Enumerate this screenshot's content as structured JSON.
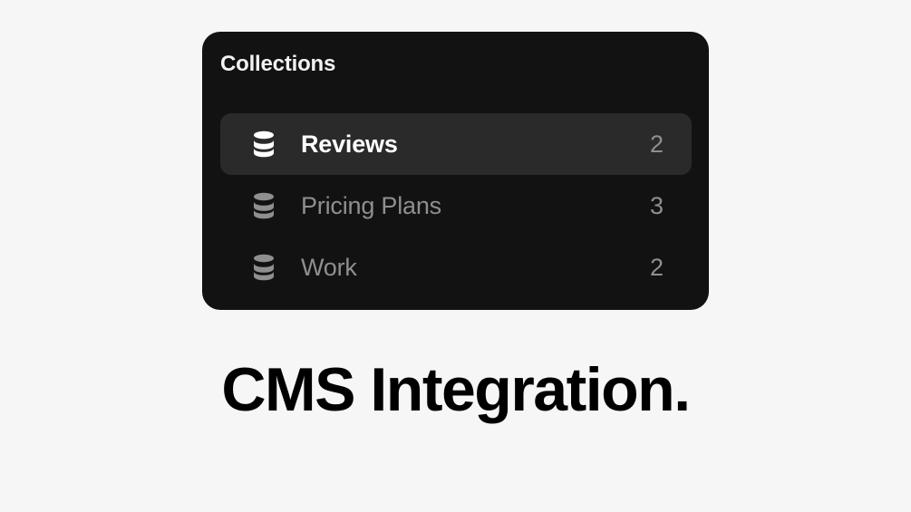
{
  "panel": {
    "title": "Collections",
    "items": [
      {
        "label": "Reviews",
        "count": "2",
        "icon": "database-icon",
        "active": true
      },
      {
        "label": "Pricing Plans",
        "count": "3",
        "icon": "database-icon",
        "active": false
      },
      {
        "label": "Work",
        "count": "2",
        "icon": "database-icon",
        "active": false
      }
    ]
  },
  "headline": "CMS Integration.",
  "colors": {
    "page_background": "#f6f6f6",
    "panel_background": "#121212",
    "active_row_background": "#2a2a2a",
    "active_text": "#ffffff",
    "muted_text": "#8f8f8f",
    "headline_text": "#000000"
  }
}
